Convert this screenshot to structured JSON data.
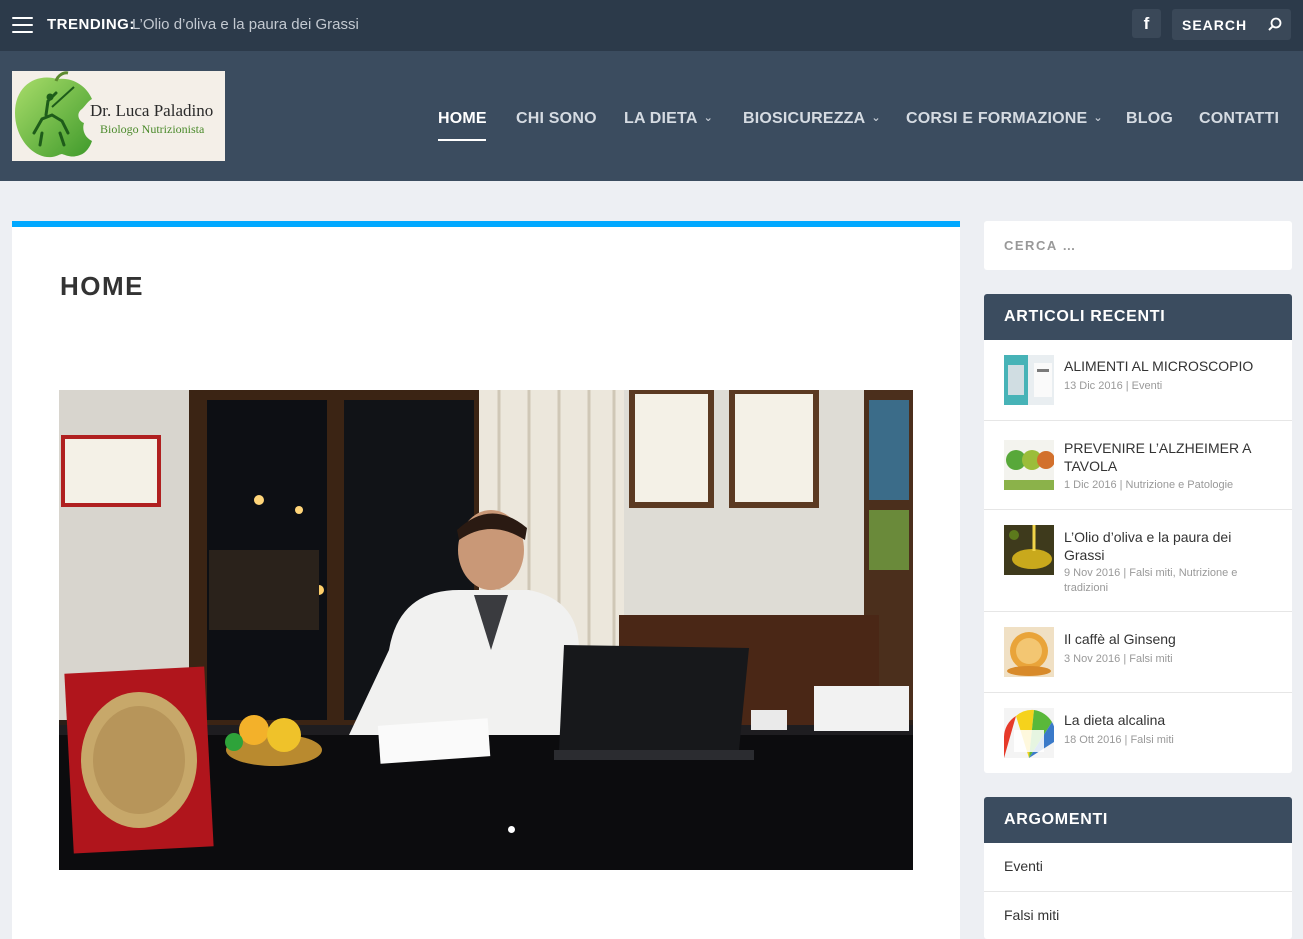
{
  "topbar": {
    "trending_label": "TRENDING:",
    "trending_text": "L’Olio d’oliva e la paura dei Grassi",
    "facebook_letter": "f",
    "search_label": "SEARCH"
  },
  "logo": {
    "name": "Dr. Luca Paladino",
    "subtitle": "Biologo Nutrizionista"
  },
  "nav": {
    "items": [
      {
        "label": "HOME",
        "active": true
      },
      {
        "label": "CHI SONO"
      },
      {
        "label": "LA DIETA",
        "dropdown": true
      },
      {
        "label": "BIOSICUREZZA",
        "dropdown": true
      },
      {
        "label": "CORSI E FORMAZIONE",
        "dropdown": true
      },
      {
        "label": "BLOG"
      },
      {
        "label": "CONTATTI"
      }
    ]
  },
  "main": {
    "title": "HOME"
  },
  "sidebar": {
    "search_placeholder": "CERCA …",
    "recent": {
      "heading": "ARTICOLI RECENTI",
      "posts": [
        {
          "title": "ALIMENTI AL MICROSCOPIO",
          "meta": "13 Dic 2016 | Eventi"
        },
        {
          "title": "PREVENIRE L’ALZHEIMER A TAVOLA",
          "meta": "1 Dic 2016 | Nutrizione e Patologie"
        },
        {
          "title": "L’Olio d’oliva e la paura dei Grassi",
          "meta": "9 Nov 2016 | Falsi miti, Nutrizione e tradizioni"
        },
        {
          "title": "Il caffè al Ginseng",
          "meta": "3 Nov 2016 | Falsi miti"
        },
        {
          "title": "La dieta alcalina",
          "meta": "18 Ott 2016 | Falsi miti"
        }
      ]
    },
    "topics": {
      "heading": "ARGOMENTI",
      "items": [
        "Eventi",
        "Falsi miti"
      ]
    }
  },
  "colors": {
    "topbar": "#2c3a4a",
    "header": "#3b4c5f",
    "accent": "#00a8ff",
    "background": "#edeff3"
  }
}
